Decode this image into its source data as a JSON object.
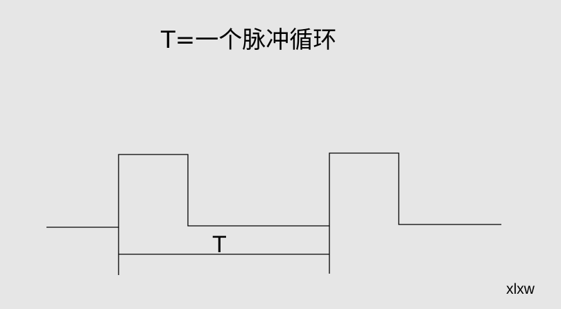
{
  "title": "T=一个脉冲循环",
  "period_label": "T",
  "watermark": "xlxw",
  "colors": {
    "background": "#e6e6e6",
    "line": "#000000"
  }
}
